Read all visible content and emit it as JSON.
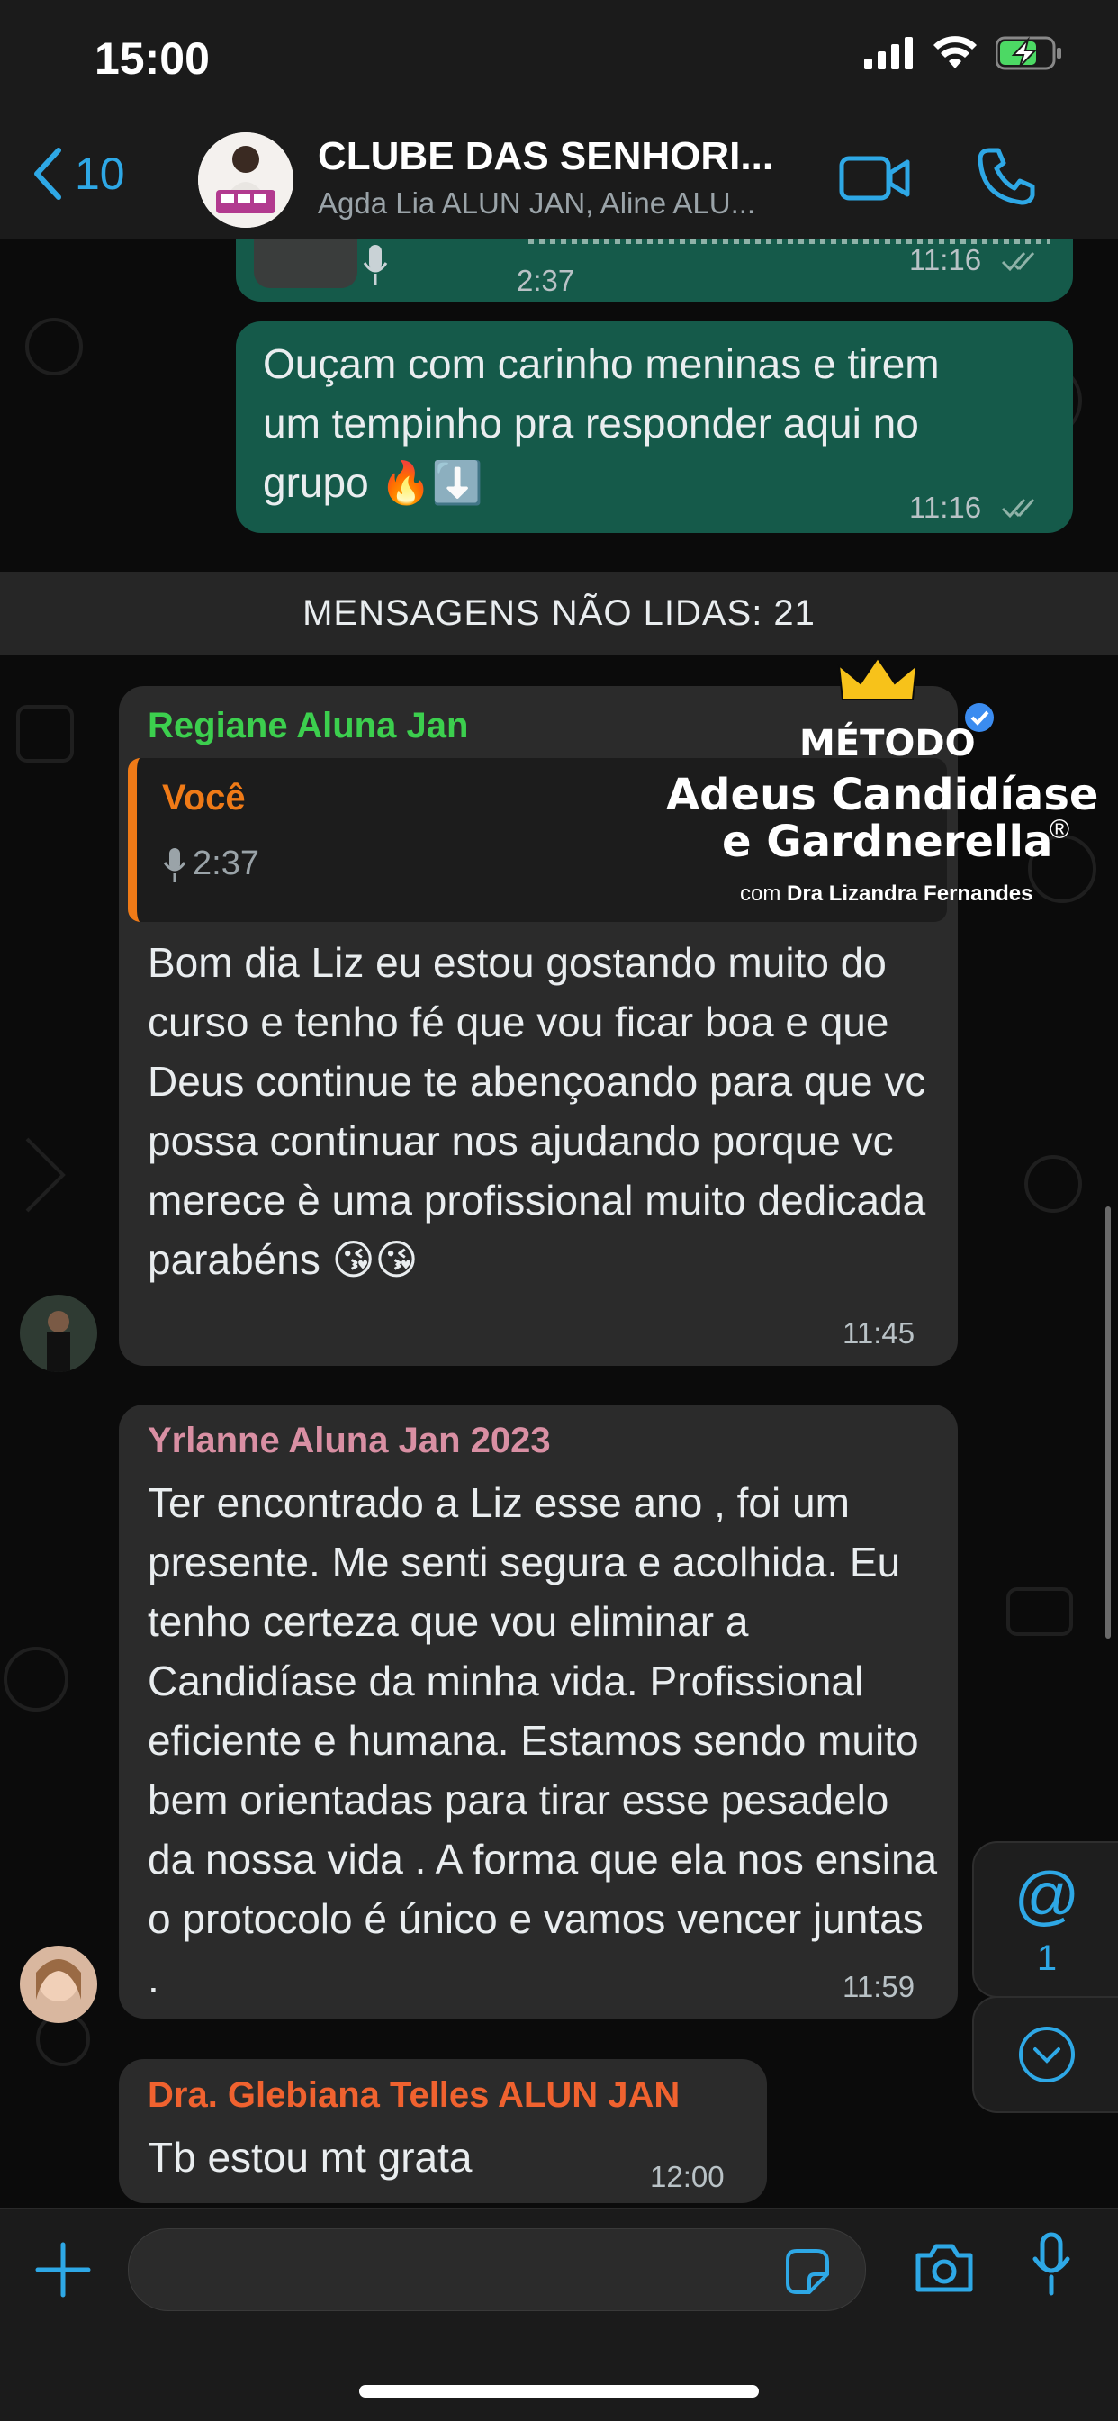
{
  "status": {
    "time": "15:00"
  },
  "header": {
    "back_count": "10",
    "title": "CLUBE DAS SENHORI...",
    "subtitle": "Agda Lia ALUN JAN, Aline ALU..."
  },
  "messages": {
    "audio_partial": {
      "duration": "2:37",
      "time": "11:16"
    },
    "outgoing_text": {
      "text": "Ouçam com carinho meninas e tirem um tempinho pra responder aqui no grupo 🔥⬇️",
      "time": "11:16"
    },
    "unread_divider": "MENSAGENS NÃO LIDAS: 21",
    "regiane": {
      "sender": "Regiane Aluna Jan",
      "quote_author": "Você",
      "quote_duration": "2:37",
      "text": "Bom dia Liz eu  estou gostando muito do curso e tenho fé que vou ficar boa e que Deus continue te abençoando para que vc possa continuar nos ajudando porque vc merece è uma profissional muito dedicada parabéns 😘😘",
      "time": "11:45"
    },
    "yrlanne": {
      "sender": "Yrlanne Aluna Jan 2023",
      "text": "Ter encontrado a Liz esse ano , foi um presente. Me senti segura e acolhida. Eu tenho certeza que vou eliminar a Candidíase da minha vida. Profissional eficiente e humana. Estamos sendo muito bem orientadas para tirar esse pesadelo da nossa vida .  A forma que ela nos ensina o protocolo é único e vamos vencer juntas .",
      "time": "11:59"
    },
    "glebiana": {
      "sender": "Dra. Glebiana Telles ALUN JAN",
      "text": "Tb estou mt grata",
      "time": "12:00"
    }
  },
  "mentions": {
    "symbol": "@",
    "count": "1"
  },
  "overlay_logo": {
    "line1": "MÉTODO",
    "line2": "Adeus Candidíase",
    "line3": "e Gardnerella",
    "registered": "®",
    "byline_prefix": "com",
    "byline_name": "Dra Lizandra Fernandes"
  },
  "colors": {
    "accent": "#2ea8e6",
    "outgoing_bubble": "#155a4a",
    "incoming_bubble": "#2b2b2b",
    "sender_regiane": "#3ccf4e",
    "sender_yrlanne": "#d98fa3",
    "sender_glebiana": "#f0622f",
    "quote_author": "#ef7a17"
  }
}
